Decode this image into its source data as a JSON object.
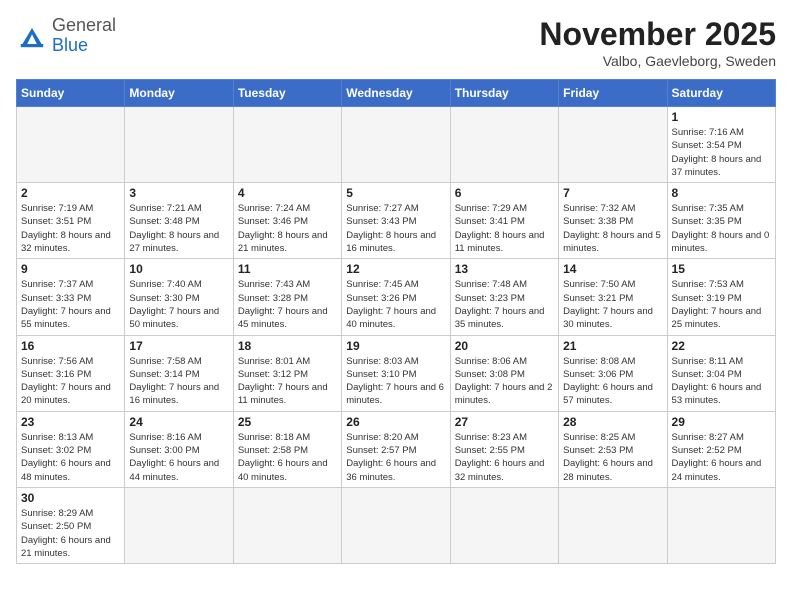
{
  "logo": {
    "general": "General",
    "blue": "Blue"
  },
  "title": "November 2025",
  "subtitle": "Valbo, Gaevleborg, Sweden",
  "days_of_week": [
    "Sunday",
    "Monday",
    "Tuesday",
    "Wednesday",
    "Thursday",
    "Friday",
    "Saturday"
  ],
  "weeks": [
    [
      {
        "day": "",
        "info": ""
      },
      {
        "day": "",
        "info": ""
      },
      {
        "day": "",
        "info": ""
      },
      {
        "day": "",
        "info": ""
      },
      {
        "day": "",
        "info": ""
      },
      {
        "day": "",
        "info": ""
      },
      {
        "day": "1",
        "info": "Sunrise: 7:16 AM\nSunset: 3:54 PM\nDaylight: 8 hours\nand 37 minutes."
      }
    ],
    [
      {
        "day": "2",
        "info": "Sunrise: 7:19 AM\nSunset: 3:51 PM\nDaylight: 8 hours\nand 32 minutes."
      },
      {
        "day": "3",
        "info": "Sunrise: 7:21 AM\nSunset: 3:48 PM\nDaylight: 8 hours\nand 27 minutes."
      },
      {
        "day": "4",
        "info": "Sunrise: 7:24 AM\nSunset: 3:46 PM\nDaylight: 8 hours\nand 21 minutes."
      },
      {
        "day": "5",
        "info": "Sunrise: 7:27 AM\nSunset: 3:43 PM\nDaylight: 8 hours\nand 16 minutes."
      },
      {
        "day": "6",
        "info": "Sunrise: 7:29 AM\nSunset: 3:41 PM\nDaylight: 8 hours\nand 11 minutes."
      },
      {
        "day": "7",
        "info": "Sunrise: 7:32 AM\nSunset: 3:38 PM\nDaylight: 8 hours\nand 5 minutes."
      },
      {
        "day": "8",
        "info": "Sunrise: 7:35 AM\nSunset: 3:35 PM\nDaylight: 8 hours\nand 0 minutes."
      }
    ],
    [
      {
        "day": "9",
        "info": "Sunrise: 7:37 AM\nSunset: 3:33 PM\nDaylight: 7 hours\nand 55 minutes."
      },
      {
        "day": "10",
        "info": "Sunrise: 7:40 AM\nSunset: 3:30 PM\nDaylight: 7 hours\nand 50 minutes."
      },
      {
        "day": "11",
        "info": "Sunrise: 7:43 AM\nSunset: 3:28 PM\nDaylight: 7 hours\nand 45 minutes."
      },
      {
        "day": "12",
        "info": "Sunrise: 7:45 AM\nSunset: 3:26 PM\nDaylight: 7 hours\nand 40 minutes."
      },
      {
        "day": "13",
        "info": "Sunrise: 7:48 AM\nSunset: 3:23 PM\nDaylight: 7 hours\nand 35 minutes."
      },
      {
        "day": "14",
        "info": "Sunrise: 7:50 AM\nSunset: 3:21 PM\nDaylight: 7 hours\nand 30 minutes."
      },
      {
        "day": "15",
        "info": "Sunrise: 7:53 AM\nSunset: 3:19 PM\nDaylight: 7 hours\nand 25 minutes."
      }
    ],
    [
      {
        "day": "16",
        "info": "Sunrise: 7:56 AM\nSunset: 3:16 PM\nDaylight: 7 hours\nand 20 minutes."
      },
      {
        "day": "17",
        "info": "Sunrise: 7:58 AM\nSunset: 3:14 PM\nDaylight: 7 hours\nand 16 minutes."
      },
      {
        "day": "18",
        "info": "Sunrise: 8:01 AM\nSunset: 3:12 PM\nDaylight: 7 hours\nand 11 minutes."
      },
      {
        "day": "19",
        "info": "Sunrise: 8:03 AM\nSunset: 3:10 PM\nDaylight: 7 hours\nand 6 minutes."
      },
      {
        "day": "20",
        "info": "Sunrise: 8:06 AM\nSunset: 3:08 PM\nDaylight: 7 hours\nand 2 minutes."
      },
      {
        "day": "21",
        "info": "Sunrise: 8:08 AM\nSunset: 3:06 PM\nDaylight: 6 hours\nand 57 minutes."
      },
      {
        "day": "22",
        "info": "Sunrise: 8:11 AM\nSunset: 3:04 PM\nDaylight: 6 hours\nand 53 minutes."
      }
    ],
    [
      {
        "day": "23",
        "info": "Sunrise: 8:13 AM\nSunset: 3:02 PM\nDaylight: 6 hours\nand 48 minutes."
      },
      {
        "day": "24",
        "info": "Sunrise: 8:16 AM\nSunset: 3:00 PM\nDaylight: 6 hours\nand 44 minutes."
      },
      {
        "day": "25",
        "info": "Sunrise: 8:18 AM\nSunset: 2:58 PM\nDaylight: 6 hours\nand 40 minutes."
      },
      {
        "day": "26",
        "info": "Sunrise: 8:20 AM\nSunset: 2:57 PM\nDaylight: 6 hours\nand 36 minutes."
      },
      {
        "day": "27",
        "info": "Sunrise: 8:23 AM\nSunset: 2:55 PM\nDaylight: 6 hours\nand 32 minutes."
      },
      {
        "day": "28",
        "info": "Sunrise: 8:25 AM\nSunset: 2:53 PM\nDaylight: 6 hours\nand 28 minutes."
      },
      {
        "day": "29",
        "info": "Sunrise: 8:27 AM\nSunset: 2:52 PM\nDaylight: 6 hours\nand 24 minutes."
      }
    ],
    [
      {
        "day": "30",
        "info": "Sunrise: 8:29 AM\nSunset: 2:50 PM\nDaylight: 6 hours\nand 21 minutes."
      },
      {
        "day": "",
        "info": ""
      },
      {
        "day": "",
        "info": ""
      },
      {
        "day": "",
        "info": ""
      },
      {
        "day": "",
        "info": ""
      },
      {
        "day": "",
        "info": ""
      },
      {
        "day": "",
        "info": ""
      }
    ]
  ]
}
